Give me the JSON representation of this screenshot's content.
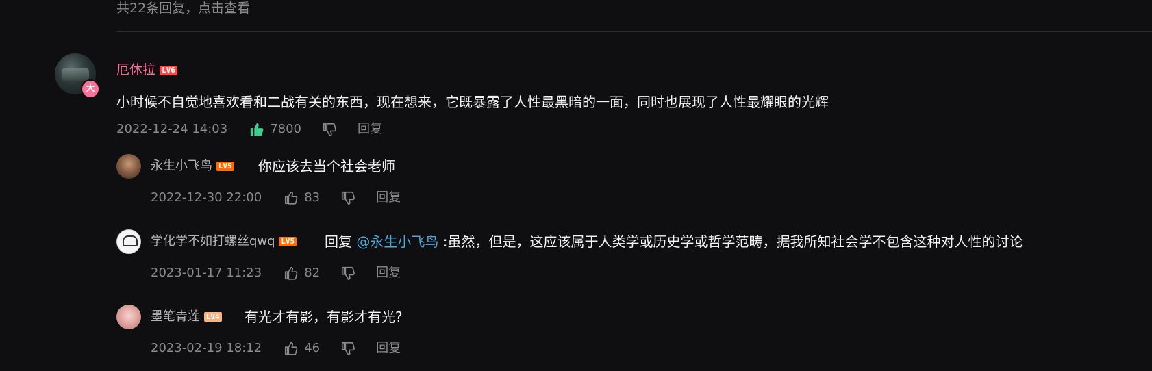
{
  "replies_hint": "共22条回复，点击查看",
  "main_comment": {
    "username": "厄休拉",
    "level": "LV6",
    "vip_badge": "大",
    "content": "小时候不自觉地喜欢看和二战有关的东西，现在想来，它既暴露了人性最黑暗的一面，同时也展现了人性最耀眼的光辉",
    "time": "2022-12-24 14:03",
    "likes": "7800",
    "reply_label": "回复",
    "liked": true,
    "like_color": "#3ccf8e"
  },
  "sub_replies": [
    {
      "username": "永生小飞鸟",
      "level": "LV5",
      "content": "你应该去当个社会老师",
      "time": "2022-12-30 22:00",
      "likes": "83",
      "reply_label": "回复"
    },
    {
      "username": "学化学不如打螺丝qwq",
      "level": "LV5",
      "reply_prefix": "回复",
      "mention": "@永生小飞鸟",
      "content": ":虽然，但是，这应该属于人类学或历史学或哲学范畴，据我所知社会学不包含这种对人性的讨论",
      "time": "2023-01-17 11:23",
      "likes": "82",
      "reply_label": "回复"
    },
    {
      "username": "墨笔青莲",
      "level": "LV4",
      "content": "有光才有影，有影才有光?",
      "time": "2023-02-19 18:12",
      "likes": "46",
      "reply_label": "回复"
    }
  ]
}
